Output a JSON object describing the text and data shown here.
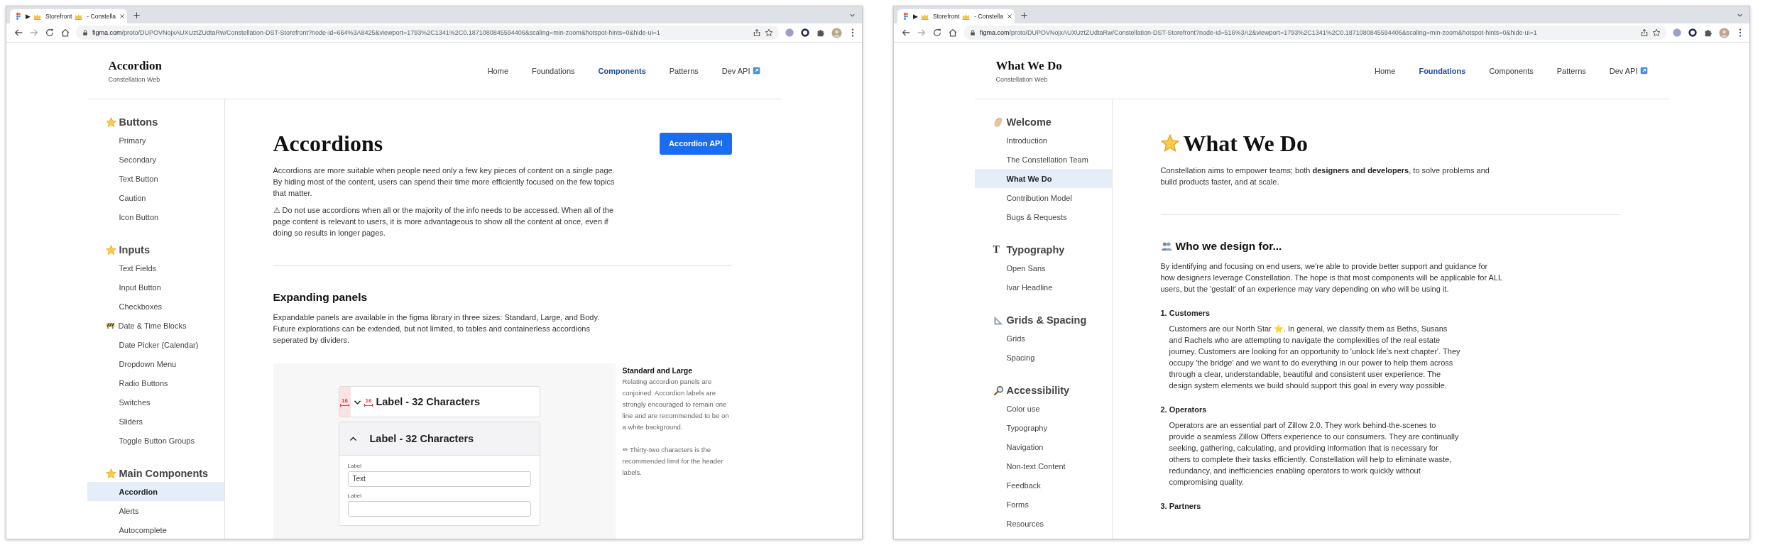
{
  "windows": [
    {
      "tab": {
        "parts": [
          {
            "kind": "text",
            "text": "▶"
          },
          {
            "kind": "crown"
          },
          {
            "kind": "text",
            "text": "Storefront"
          },
          {
            "kind": "crown"
          },
          {
            "kind": "text",
            "text": "- Constella"
          }
        ]
      },
      "url": {
        "host": "figma.com",
        "path": "/proto/DUPOVNojxAUXUztZUdtaRw/Constellation-DST-Storefront?node-id=664%3A8425&viewport=1793%2C1341%2C0.1871080845594406&scaling=min-zoom&hotspot-hints=0&hide-ui=1"
      },
      "site": {
        "title": "Accordion",
        "subtitle": "Constellation Web"
      },
      "nav": [
        {
          "label": "Home",
          "selected": false
        },
        {
          "label": "Foundations",
          "selected": false
        },
        {
          "label": "Components",
          "selected": true
        },
        {
          "label": "Patterns",
          "selected": false
        },
        {
          "label": "Dev API",
          "selected": false,
          "external": true
        }
      ],
      "sidebar": [
        {
          "kind": "star",
          "heading": "Buttons",
          "items": [
            {
              "kind": "link",
              "label": "Primary",
              "selected": false
            },
            {
              "kind": "link",
              "label": "Secondary",
              "selected": false
            },
            {
              "kind": "link",
              "label": "Text Button",
              "selected": false
            },
            {
              "kind": "link",
              "label": "Caution",
              "selected": false
            },
            {
              "kind": "link",
              "label": "Icon Button",
              "selected": false
            }
          ]
        },
        {
          "kind": "star",
          "heading": "Inputs",
          "items": [
            {
              "kind": "link",
              "label": "Text Fields",
              "selected": false
            },
            {
              "kind": "link",
              "label": "Input Button",
              "selected": false
            },
            {
              "kind": "link",
              "label": "Checkboxes",
              "selected": false
            },
            {
              "kind": "barrier",
              "label": "Date & Time Blocks",
              "selected": false
            },
            {
              "kind": "link",
              "label": "Date Picker (Calendar)",
              "selected": false
            },
            {
              "kind": "link",
              "label": "Dropdown Menu",
              "selected": false
            },
            {
              "kind": "link",
              "label": "Radio Buttons",
              "selected": false
            },
            {
              "kind": "link",
              "label": "Switches",
              "selected": false
            },
            {
              "kind": "link",
              "label": "Sliders",
              "selected": false
            },
            {
              "kind": "link",
              "label": "Toggle Button Groups",
              "selected": false
            }
          ]
        },
        {
          "kind": "star",
          "heading": "Main Components",
          "items": [
            {
              "kind": "link",
              "label": "Accordion",
              "selected": true
            },
            {
              "kind": "link",
              "label": "Alerts",
              "selected": false
            },
            {
              "kind": "link",
              "label": "Autocomplete",
              "selected": false
            }
          ]
        }
      ],
      "main": {
        "blocks": [
          {
            "kind": "title",
            "text": "Accordions",
            "button": "Accordion API"
          },
          {
            "kind": "paragraph",
            "parts": [
              {
                "kind": "text",
                "text": "Accordions are more suitable when people need only a few key pieces of content on a single page. By hiding most of the content, users can spend their time more efficiently focused on the few topics that matter."
              }
            ]
          },
          {
            "kind": "paragraph",
            "parts": [
              {
                "kind": "text",
                "text": "⚠ Do not use accordions when all or the majority of the info needs to be accessed. When all of the page content is relevant to users, it is more advantageous to show all the content at once, even if doing so results in longer pages."
              }
            ]
          },
          {
            "kind": "divider"
          },
          {
            "kind": "heading",
            "text": "Expanding panels"
          },
          {
            "kind": "paragraph",
            "parts": [
              {
                "kind": "text",
                "text": "Expandable panels are available in the figma library in three sizes: Standard, Large, and Body. Future explorations can be extended, but not limited, to tables and containerless accordions seperated by dividers."
              }
            ]
          },
          {
            "kind": "demo",
            "panels": [
              {
                "label": "Label - 32 Characters",
                "expanded": false,
                "spacing_marks": [
                  "16",
                  "16"
                ]
              },
              {
                "label": "Label - 32 Characters",
                "expanded": true,
                "fields": [
                  {
                    "label": "Label",
                    "value": "Text"
                  },
                  {
                    "label": "Label"
                  }
                ]
              }
            ],
            "note": {
              "title": "Standard and Large",
              "paragraphs": [
                {
                  "parts": [
                    {
                      "kind": "text",
                      "text": "Relating accordion panels are conjoined. Accordion labels are strongly encouraged to remain one line and are recommended to be on a white background."
                    }
                  ]
                },
                {
                  "parts": [
                    {
                      "kind": "text",
                      "text": "✏ Thirty-two characters is the recommended limit for the header labels."
                    }
                  ]
                }
              ]
            }
          }
        ]
      }
    },
    {
      "tab": {
        "parts": [
          {
            "kind": "text",
            "text": "▶"
          },
          {
            "kind": "crown"
          },
          {
            "kind": "text",
            "text": "Storefront"
          },
          {
            "kind": "crown"
          },
          {
            "kind": "text",
            "text": "- Constella"
          }
        ]
      },
      "url": {
        "host": "figma.com",
        "path": "/proto/DUPOVNojxAUXUztZUdtaRw/Constellation-DST-Storefront?node-id=516%3A2&viewport=1793%2C1341%2C0.1871080845594406&scaling=min-zoom&hotspot-hints=0&hide-ui=1"
      },
      "site": {
        "title": "What We Do",
        "subtitle": "Constellation Web"
      },
      "nav": [
        {
          "label": "Home",
          "selected": false
        },
        {
          "label": "Foundations",
          "selected": true
        },
        {
          "label": "Components",
          "selected": false
        },
        {
          "label": "Patterns",
          "selected": false
        },
        {
          "label": "Dev API",
          "selected": false,
          "external": true
        }
      ],
      "sidebar": [
        {
          "kind": "hand",
          "heading": "Welcome",
          "items": [
            {
              "kind": "link",
              "label": "Introduction",
              "selected": false
            },
            {
              "kind": "link",
              "label": "The Constellation Team",
              "selected": false
            },
            {
              "kind": "link",
              "label": "What We Do",
              "selected": true
            },
            {
              "kind": "link",
              "label": "Contribution Model",
              "selected": false
            },
            {
              "kind": "link",
              "label": "Bugs & Requests",
              "selected": false
            }
          ]
        },
        {
          "kind": "glyph",
          "glyph": "T",
          "heading": "Typography",
          "items": [
            {
              "kind": "link",
              "label": "Open Sans",
              "selected": false
            },
            {
              "kind": "link",
              "label": "Ivar Headline",
              "selected": false
            }
          ]
        },
        {
          "kind": "ruler",
          "heading": "Grids & Spacing",
          "items": [
            {
              "kind": "link",
              "label": "Grids",
              "selected": false
            },
            {
              "kind": "link",
              "label": "Spacing",
              "selected": false
            }
          ]
        },
        {
          "kind": "magnifier",
          "heading": "Accessibility",
          "items": [
            {
              "kind": "link",
              "label": "Color use",
              "selected": false
            },
            {
              "kind": "link",
              "label": "Typography",
              "selected": false
            },
            {
              "kind": "link",
              "label": "Navigation",
              "selected": false
            },
            {
              "kind": "link",
              "label": "Non-text Content",
              "selected": false
            },
            {
              "kind": "link",
              "label": "Feedback",
              "selected": false
            },
            {
              "kind": "link",
              "label": "Forms",
              "selected": false
            },
            {
              "kind": "link",
              "label": "Resources",
              "selected": false
            }
          ]
        }
      ],
      "main": {
        "blocks": [
          {
            "kind": "startitle",
            "text": "What We Do"
          },
          {
            "kind": "paragraph",
            "parts": [
              {
                "kind": "text",
                "text": "Constellation aims to empower teams; both **designers and developers**, to solve problems and build products faster, and at scale."
              }
            ]
          },
          {
            "kind": "divider"
          },
          {
            "kind": "peopleheading",
            "text": "Who we design for..."
          },
          {
            "kind": "paragraph",
            "parts": [
              {
                "kind": "text",
                "text": "By identifying and focusing on end users, we're able to provide better support and guidance for how designers leverage Constellation. The hope is that most components will be applicable for ALL users, but the 'gestalt' of an experience may vary depending on who will be using it."
              }
            ]
          },
          {
            "kind": "subheading",
            "text": "1. Customers"
          },
          {
            "kind": "paragraph",
            "indented": true,
            "parts": [
              {
                "kind": "text",
                "text": "Customers are our North Star ⭐. In general, we classify them as Beths, Susans and Rachels who are attempting to navigate the complexities of the real estate journey. Customers are looking for an opportunity to 'unlock life's next chapter'. They occupy 'the bridge' and we want to do everything in our power to help them across through a clear, understandable, beautiful and consistent user experience. The design system elements we build should support this goal in every way possible."
              }
            ]
          },
          {
            "kind": "subheading",
            "text": "2. Operators"
          },
          {
            "kind": "paragraph",
            "indented": true,
            "parts": [
              {
                "kind": "text",
                "text": "Operators are an essential part of Zillow 2.0. They work behind-the-scenes to provide a seamless Zillow Offers experience to our consumers. They are continually seeking, gathering, calculating, and providing information that is necessary for others to complete their tasks efficiently. Constellation will help to eliminate waste, redundancy, and inefficiencies enabling operators to work quickly without compromising quality."
              }
            ]
          },
          {
            "kind": "subheading",
            "text": "3. Partners"
          }
        ]
      }
    }
  ]
}
